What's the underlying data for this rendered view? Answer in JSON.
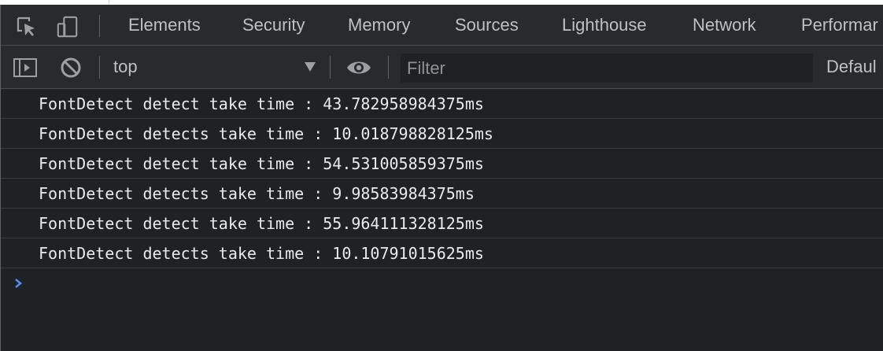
{
  "devtools": {
    "tabs": [
      {
        "label": "Elements"
      },
      {
        "label": "Security"
      },
      {
        "label": "Memory"
      },
      {
        "label": "Sources"
      },
      {
        "label": "Lighthouse"
      },
      {
        "label": "Network"
      },
      {
        "label": "Performar"
      }
    ],
    "icons": {
      "inspect": "inspect-element-icon",
      "device": "device-toolbar-icon",
      "sidebar": "console-sidebar-icon",
      "clear": "clear-console-icon",
      "live_expression": "eye-icon",
      "prompt": "prompt-chevron-icon"
    }
  },
  "console_toolbar": {
    "context": "top",
    "filter_placeholder": "Filter",
    "levels_label": "Defaul"
  },
  "console": {
    "messages": [
      "FontDetect detect take time : 43.782958984375ms",
      "FontDetect detects take time : 10.018798828125ms",
      "FontDetect detect take time : 54.531005859375ms",
      "FontDetect detects take time : 9.98583984375ms",
      "FontDetect detect take time : 55.964111328125ms",
      "FontDetect detects take time : 10.10791015625ms"
    ]
  },
  "colors": {
    "background": "#202124",
    "toolbar": "#292a2d",
    "text": "#e8eaed",
    "prompt_accent": "#4d8ff7"
  }
}
